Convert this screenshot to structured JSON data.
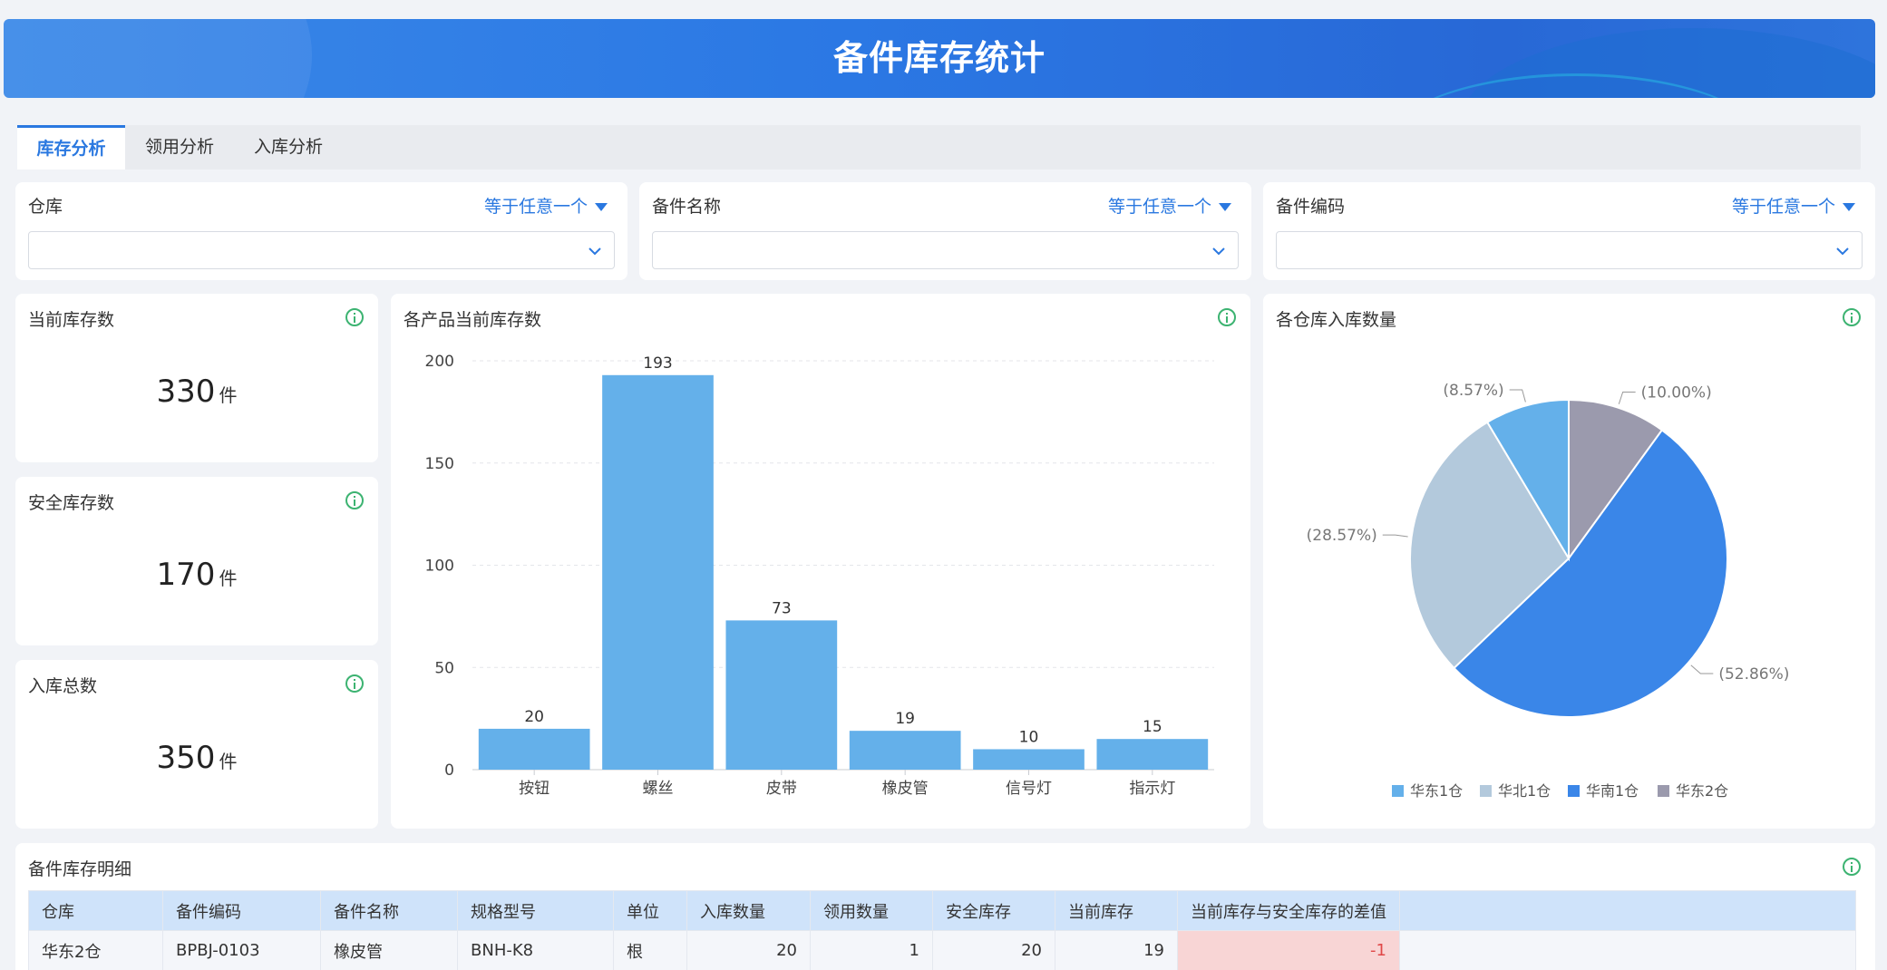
{
  "header": {
    "title": "备件库存统计"
  },
  "tabs": [
    {
      "label": "库存分析",
      "active": true
    },
    {
      "label": "领用分析",
      "active": false
    },
    {
      "label": "入库分析",
      "active": false
    }
  ],
  "filters": [
    {
      "label": "仓库",
      "operator": "等于任意一个",
      "value": ""
    },
    {
      "label": "备件名称",
      "operator": "等于任意一个",
      "value": ""
    },
    {
      "label": "备件编码",
      "operator": "等于任意一个",
      "value": ""
    }
  ],
  "kpis": [
    {
      "title": "当前库存数",
      "value": "330",
      "unit": "件"
    },
    {
      "title": "安全库存数",
      "value": "170",
      "unit": "件"
    },
    {
      "title": "入库总数",
      "value": "350",
      "unit": "件"
    }
  ],
  "chart_data": [
    {
      "type": "bar",
      "title": "各产品当前库存数",
      "categories": [
        "按钮",
        "螺丝",
        "皮带",
        "橡皮管",
        "信号灯",
        "指示灯"
      ],
      "values": [
        20,
        193,
        73,
        19,
        10,
        15
      ],
      "yticks": [
        0,
        50,
        100,
        150,
        200
      ],
      "ylim": [
        0,
        200
      ],
      "grid": true,
      "color": "#64b0ea"
    },
    {
      "type": "pie",
      "title": "各仓库入库数量",
      "legend_position": "bottom",
      "slices": [
        {
          "name": "华东1仓",
          "value": 8.57,
          "label": "(8.57%)",
          "color": "#64b0ea"
        },
        {
          "name": "华北1仓",
          "value": 28.57,
          "label": "(28.57%)",
          "color": "#b3c9dc"
        },
        {
          "name": "华南1仓",
          "value": 52.86,
          "label": "(52.86%)",
          "color": "#3a86e8"
        },
        {
          "name": "华东2仓",
          "value": 10.0,
          "label": "(10.00%)",
          "color": "#9b9aad"
        }
      ]
    }
  ],
  "detail": {
    "title": "备件库存明细",
    "columns": [
      "仓库",
      "备件编码",
      "备件名称",
      "规格型号",
      "单位",
      "入库数量",
      "领用数量",
      "安全库存",
      "当前库存",
      "当前库存与安全库存的差值"
    ],
    "rows": [
      [
        "华东2仓",
        "BPBJ-0103",
        "橡皮管",
        "BNH-K8",
        "根",
        "20",
        "1",
        "20",
        "19",
        "-1"
      ]
    ]
  }
}
